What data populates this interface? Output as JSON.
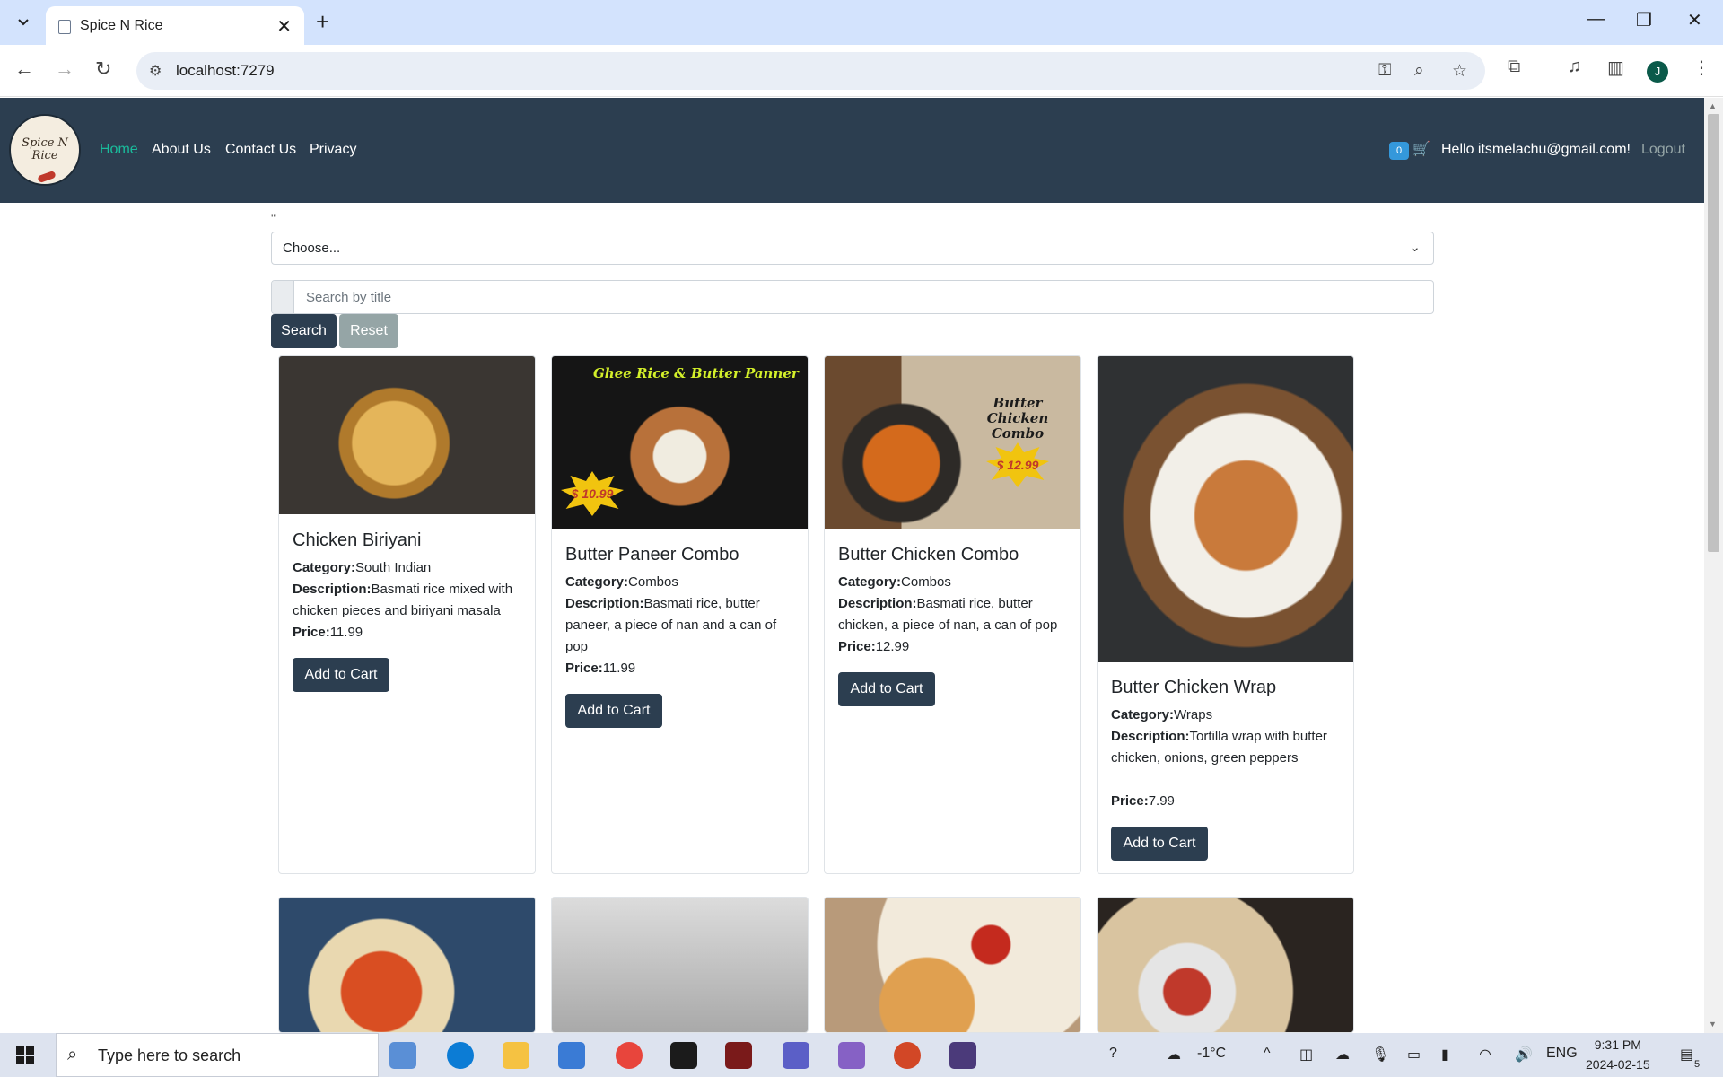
{
  "browser": {
    "tab_title": "Spice N Rice",
    "url": "localhost:7279",
    "profile_initial": "J"
  },
  "nav": {
    "logo_text": "Spice N Rice",
    "links": [
      "Home",
      "About Us",
      "Contact Us",
      "Privacy"
    ],
    "cart_count": "0",
    "greeting": "Hello itsmelachu@gmail.com!",
    "logout": "Logout"
  },
  "filters": {
    "stray_text": "\"",
    "category_select": "Choose...",
    "search_placeholder": "Search by title",
    "search_label": "Search",
    "reset_label": "Reset"
  },
  "labels": {
    "category": "Category:",
    "description": "Description:",
    "price": "Price:",
    "add_to_cart": "Add to Cart"
  },
  "products": [
    {
      "name": "Chicken Biriyani",
      "category": "South Indian",
      "description": "Basmati rice mixed with chicken pieces and biriyani masala",
      "price": "11.99"
    },
    {
      "name": "Butter Paneer Combo",
      "category": "Combos",
      "description": "Basmati rice, butter paneer, a piece of nan and a can of pop",
      "price": "11.99",
      "promo_title": "Ghee Rice & Butter Panner",
      "promo_price": "$ 10.99"
    },
    {
      "name": "Butter Chicken Combo",
      "category": "Combos",
      "description": "Basmati rice, butter chicken, a piece of nan, a can of pop",
      "price": "12.99",
      "promo_title": "Butter Chicken Combo",
      "promo_price": "$ 12.99"
    },
    {
      "name": "Butter Chicken Wrap",
      "category": "Wraps",
      "description": "Tortilla wrap with butter chicken, onions, green peppers",
      "price": "7.99"
    }
  ],
  "taskbar": {
    "search_placeholder": "Type here to search",
    "weather": "-1°C",
    "language": "ENG",
    "time": "9:31 PM",
    "date": "2024-02-15",
    "notifications": "5"
  },
  "colors": {
    "navbar": "#2c3e50",
    "active_link": "#1abc9c",
    "cart_badge": "#3498db",
    "reset_button": "#95a5a6"
  }
}
